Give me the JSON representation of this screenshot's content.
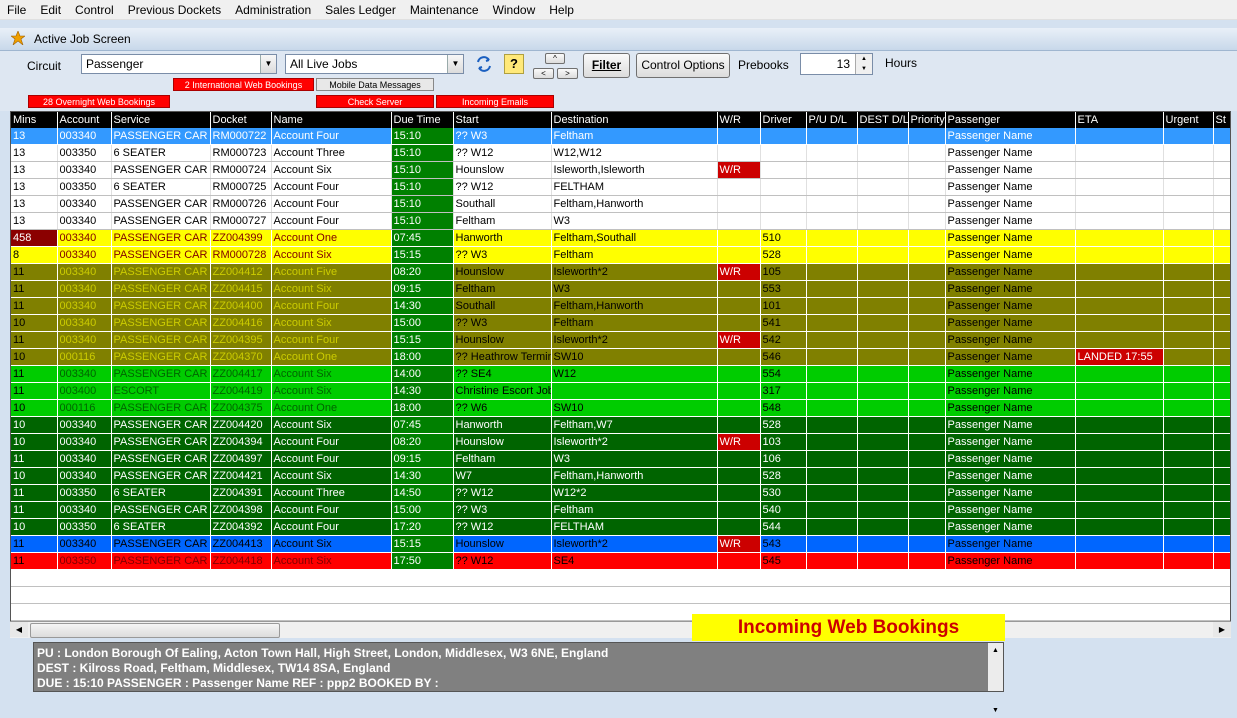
{
  "menu": [
    "File",
    "Edit",
    "Control",
    "Previous Dockets",
    "Administration",
    "Sales Ledger",
    "Maintenance",
    "Window",
    "Help"
  ],
  "window_title": "Active Job Screen",
  "toolbar": {
    "circuit_label": "Circuit",
    "circuit_value": "Passenger",
    "jobs_value": "All Live Jobs",
    "filter_label": "Filter",
    "control_options_label": "Control Options",
    "prebooks_label": "Prebooks",
    "prebooks_value": "13",
    "hours_label": "Hours",
    "help_glyph": "?",
    "up_glyph": "^",
    "left_glyph": "<",
    "right_glyph": ">"
  },
  "tags": {
    "intl_web": "2 International Web Bookings",
    "mobile": "Mobile Data Messages",
    "overnight": "28 Overnight Web Bookings",
    "check_server": "Check Server",
    "incoming_emails": "Incoming Emails"
  },
  "columns": [
    "Mins",
    "Account",
    "Service",
    "Docket",
    "Name",
    "Due Time",
    "Start",
    "Destination",
    "W/R",
    "Driver",
    "P/U D/L",
    "DEST D/L",
    "Priority",
    "Passenger",
    "ETA",
    "Urgent",
    "St"
  ],
  "rows": [
    {
      "style": "blue",
      "mins": "13",
      "account": "003340",
      "service": "PASSENGER CAR",
      "docket": "RM000722",
      "name": "Account Four",
      "due": "15:10",
      "start": "?? W3",
      "dest": "Feltham",
      "wr": "",
      "driver": "",
      "passenger": "Passenger Name",
      "eta": ""
    },
    {
      "style": "white",
      "mins": "13",
      "account": "003350",
      "service": "6 SEATER",
      "docket": "RM000723",
      "name": "Account Three",
      "due": "15:10",
      "start": "?? W12",
      "dest": "W12,W12",
      "wr": "",
      "driver": "",
      "passenger": "Passenger Name",
      "eta": ""
    },
    {
      "style": "white",
      "mins": "13",
      "account": "003340",
      "service": "PASSENGER CAR",
      "docket": "RM000724",
      "name": "Account Six",
      "due": "15:10",
      "start": "Hounslow",
      "dest": "Isleworth,Isleworth",
      "wr": "W/R",
      "driver": "",
      "passenger": "Passenger Name",
      "eta": ""
    },
    {
      "style": "white",
      "mins": "13",
      "account": "003350",
      "service": "6 SEATER",
      "docket": "RM000725",
      "name": "Account Four",
      "due": "15:10",
      "start": "?? W12",
      "dest": "FELTHAM",
      "wr": "",
      "driver": "",
      "passenger": "Passenger Name",
      "eta": ""
    },
    {
      "style": "white",
      "mins": "13",
      "account": "003340",
      "service": "PASSENGER CAR",
      "docket": "RM000726",
      "name": "Account Four",
      "due": "15:10",
      "start": "Southall",
      "dest": "Feltham,Hanworth",
      "wr": "",
      "driver": "",
      "passenger": "Passenger Name",
      "eta": ""
    },
    {
      "style": "white",
      "mins": "13",
      "account": "003340",
      "service": "PASSENGER CAR",
      "docket": "RM000727",
      "name": "Account Four",
      "due": "15:10",
      "start": "Feltham",
      "dest": "W3",
      "wr": "",
      "driver": "",
      "passenger": "Passenger Name",
      "eta": ""
    },
    {
      "style": "yellow",
      "mins": "458",
      "late": true,
      "account": "003340",
      "service": "PASSENGER CAR",
      "docket": "ZZ004399",
      "name": "Account One",
      "due": "07:45",
      "start": "Hanworth",
      "dest": "Feltham,Southall",
      "wr": "",
      "driver": "510",
      "passenger": "Passenger Name",
      "eta": ""
    },
    {
      "style": "yellow",
      "mins": "8",
      "account": "003340",
      "service": "PASSENGER CAR",
      "docket": "RM000728",
      "name": "Account Six",
      "due": "15:15",
      "start": "?? W3",
      "dest": "Feltham",
      "wr": "",
      "driver": "528",
      "passenger": "Passenger Name",
      "eta": ""
    },
    {
      "style": "olive",
      "mins": "11",
      "account": "003340",
      "service": "PASSENGER CAR",
      "docket": "ZZ004412",
      "name": "Account Five",
      "due": "08:20",
      "start": "Hounslow",
      "dest": "Isleworth*2",
      "wr": "W/R",
      "driver": "105",
      "passenger": "Passenger Name",
      "eta": ""
    },
    {
      "style": "olive",
      "mins": "11",
      "account": "003340",
      "service": "PASSENGER CAR",
      "docket": "ZZ004415",
      "name": "Account Six",
      "due": "09:15",
      "start": "Feltham",
      "dest": "W3",
      "wr": "",
      "driver": "553",
      "passenger": "Passenger Name",
      "eta": ""
    },
    {
      "style": "olive",
      "mins": "11",
      "account": "003340",
      "service": "PASSENGER CAR",
      "docket": "ZZ004400",
      "name": "Account Four",
      "due": "14:30",
      "start": "Southall",
      "dest": "Feltham,Hanworth",
      "wr": "",
      "driver": "101",
      "passenger": "Passenger Name",
      "eta": ""
    },
    {
      "style": "olive",
      "mins": "10",
      "account": "003340",
      "service": "PASSENGER CAR",
      "docket": "ZZ004416",
      "name": "Account Six",
      "due": "15:00",
      "start": "?? W3",
      "dest": "Feltham",
      "wr": "",
      "driver": "541",
      "passenger": "Passenger Name",
      "eta": ""
    },
    {
      "style": "olive",
      "mins": "11",
      "account": "003340",
      "service": "PASSENGER CAR",
      "docket": "ZZ004395",
      "name": "Account Four",
      "due": "15:15",
      "start": "Hounslow",
      "dest": "Isleworth*2",
      "wr": "W/R",
      "driver": "542",
      "passenger": "Passenger Name",
      "eta": ""
    },
    {
      "style": "olive",
      "mins": "10",
      "account": "000116",
      "service": "PASSENGER CAR",
      "docket": "ZZ004370",
      "name": "Account One",
      "due": "18:00",
      "start": "?? Heathrow Termin",
      "dest": "SW10",
      "wr": "",
      "driver": "546",
      "passenger": "Passenger Name",
      "eta": "LANDED 17:55"
    },
    {
      "style": "lime",
      "mins": "11",
      "account": "003340",
      "service": "PASSENGER CAR",
      "docket": "ZZ004417",
      "name": "Account Six",
      "due": "14:00",
      "start": "?? SE4",
      "dest": "W12",
      "wr": "",
      "driver": "554",
      "passenger": "Passenger Name",
      "eta": ""
    },
    {
      "style": "lime",
      "mins": "11",
      "account": "003400",
      "service": "ESCORT",
      "docket": "ZZ004419",
      "name": "Account Six",
      "due": "14:30",
      "start": "Christine Escort Job",
      "dest": "",
      "wr": "",
      "driver": "317",
      "passenger": "Passenger Name",
      "eta": ""
    },
    {
      "style": "lime",
      "mins": "10",
      "account": "000116",
      "service": "PASSENGER CAR",
      "docket": "ZZ004375",
      "name": "Account One",
      "due": "18:00",
      "start": "?? W6",
      "dest": "SW10",
      "wr": "",
      "driver": "548",
      "passenger": "Passenger Name",
      "eta": ""
    },
    {
      "style": "dgreen",
      "mins": "10",
      "account": "003340",
      "service": "PASSENGER CAR",
      "docket": "ZZ004420",
      "name": "Account Six",
      "due": "07:45",
      "start": "Hanworth",
      "dest": "Feltham,W7",
      "wr": "",
      "driver": "528",
      "passenger": "Passenger Name",
      "eta": ""
    },
    {
      "style": "dgreen",
      "mins": "10",
      "account": "003340",
      "service": "PASSENGER CAR",
      "docket": "ZZ004394",
      "name": "Account Four",
      "due": "08:20",
      "start": "Hounslow",
      "dest": "Isleworth*2",
      "wr": "W/R",
      "driver": "103",
      "passenger": "Passenger Name",
      "eta": ""
    },
    {
      "style": "dgreen",
      "mins": "11",
      "account": "003340",
      "service": "PASSENGER CAR",
      "docket": "ZZ004397",
      "name": "Account Four",
      "due": "09:15",
      "start": "Feltham",
      "dest": "W3",
      "wr": "",
      "driver": "106",
      "passenger": "Passenger Name",
      "eta": ""
    },
    {
      "style": "dgreen",
      "mins": "10",
      "account": "003340",
      "service": "PASSENGER CAR",
      "docket": "ZZ004421",
      "name": "Account Six",
      "due": "14:30",
      "start": "W7",
      "dest": "Feltham,Hanworth",
      "wr": "",
      "driver": "528",
      "passenger": "Passenger Name",
      "eta": ""
    },
    {
      "style": "dgreen",
      "mins": "11",
      "account": "003350",
      "service": "6 SEATER",
      "docket": "ZZ004391",
      "name": "Account Three",
      "due": "14:50",
      "start": "?? W12",
      "dest": "W12*2",
      "wr": "",
      "driver": "530",
      "passenger": "Passenger Name",
      "eta": ""
    },
    {
      "style": "dgreen",
      "mins": "11",
      "account": "003340",
      "service": "PASSENGER CAR",
      "docket": "ZZ004398",
      "name": "Account Four",
      "due": "15:00",
      "start": "?? W3",
      "dest": "Feltham",
      "wr": "",
      "driver": "540",
      "passenger": "Passenger Name",
      "eta": ""
    },
    {
      "style": "dgreen",
      "mins": "10",
      "account": "003350",
      "service": "6 SEATER",
      "docket": "ZZ004392",
      "name": "Account Four",
      "due": "17:20",
      "start": "?? W12",
      "dest": "FELTHAM",
      "wr": "",
      "driver": "544",
      "passenger": "Passenger Name",
      "eta": ""
    },
    {
      "style": "bblue",
      "mins": "11",
      "account": "003340",
      "service": "PASSENGER CAR",
      "docket": "ZZ004413",
      "name": "Account Six",
      "due": "15:15",
      "start": "Hounslow",
      "dest": "Isleworth*2",
      "wr": "W/R",
      "driver": "543",
      "passenger": "Passenger Name",
      "eta": ""
    },
    {
      "style": "red",
      "mins": "11",
      "account": "003350",
      "service": "PASSENGER CAR",
      "docket": "ZZ004418",
      "name": "Account Six",
      "due": "17:50",
      "start": "?? W12",
      "dest": "SE4",
      "wr": "",
      "driver": "545",
      "passenger": "Passenger Name",
      "eta": ""
    }
  ],
  "banner": "Incoming Web Bookings",
  "info": {
    "line1": "PU : London Borough Of Ealing, Acton Town Hall, High Street, London, Middlesex, W3 6NE, England",
    "line2": "DEST :  Kilross Road,   Feltham, Middlesex, TW14 8SA, England",
    "line3": "DUE : 15:10  PASSENGER : Passenger Name  REF : ppp2  BOOKED BY :"
  }
}
